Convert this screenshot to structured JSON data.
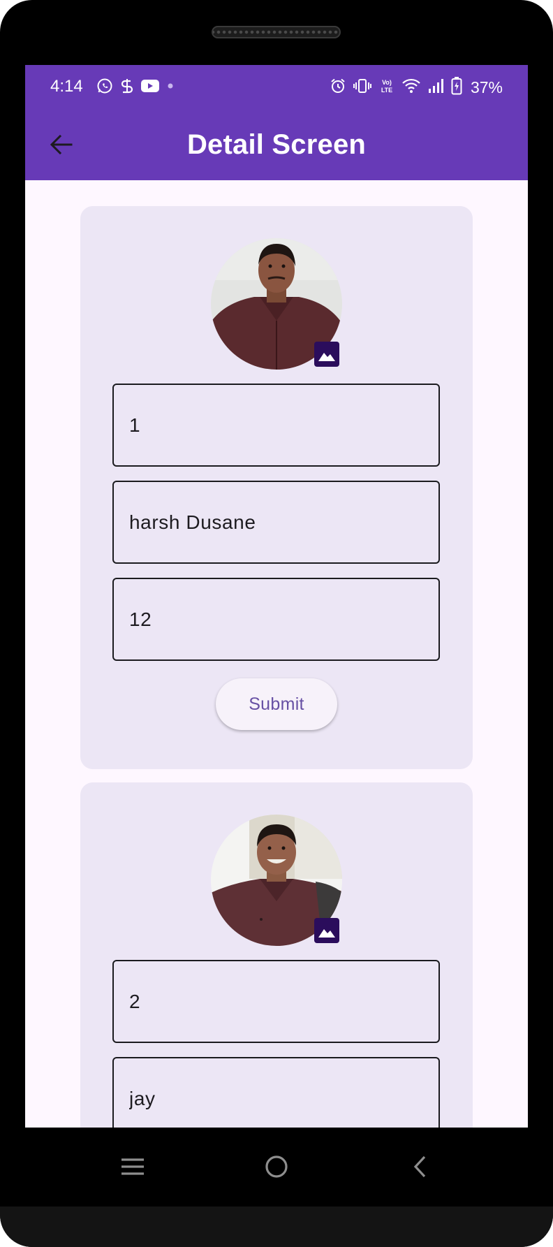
{
  "status_bar": {
    "time": "4:14",
    "battery": "37%",
    "left_icons": [
      "whatsapp-icon",
      "sync-icon",
      "youtube-icon",
      "notification-dot-icon"
    ],
    "right_icons": [
      "alarm-icon",
      "vibrate-icon",
      "volte-icon",
      "wifi-icon",
      "signal-icon",
      "battery-charging-icon"
    ],
    "color": "#673ab7"
  },
  "app_bar": {
    "title": "Detail Screen",
    "back_icon": "arrow-back-icon"
  },
  "cards": [
    {
      "avatar_icon": "image-icon",
      "fields": [
        "1",
        "harsh Dusane",
        "12"
      ],
      "submit_label": "Submit"
    },
    {
      "avatar_icon": "image-icon",
      "fields": [
        "2",
        "jay"
      ]
    }
  ],
  "nav_bar": {
    "buttons": [
      "recent-apps-icon",
      "home-icon",
      "back-icon"
    ]
  },
  "colors": {
    "accent": "#673ab7",
    "card": "#ece6f5",
    "background": "#fef7ff",
    "button_text": "#6750a4",
    "badge": "#2b0d5c"
  }
}
